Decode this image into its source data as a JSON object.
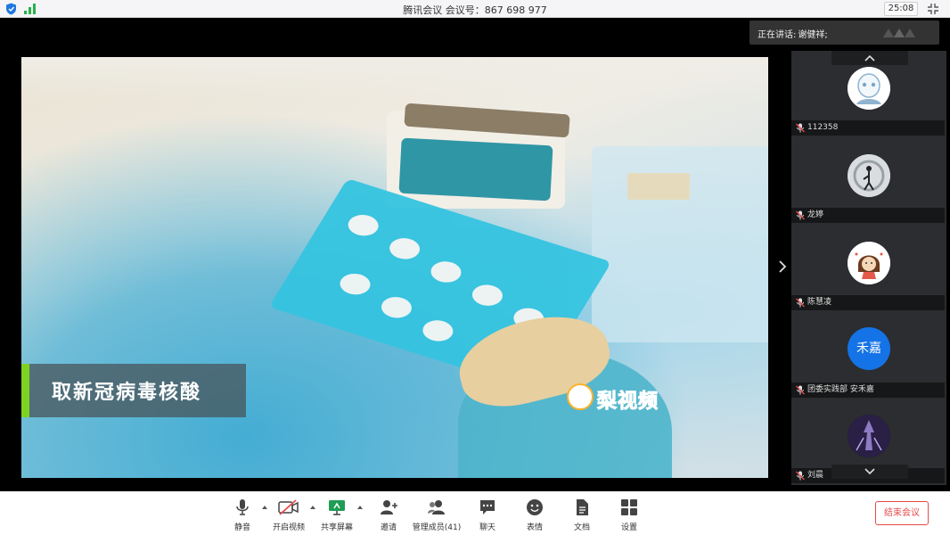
{
  "titlebar": {
    "title": "腾讯会议 会议号：867 698 977",
    "timer": "25:08"
  },
  "speaking": {
    "label": "正在讲话:",
    "name": "谢健祥;"
  },
  "video": {
    "caption": "取新冠病毒核酸",
    "watermark": "梨视频"
  },
  "participants": [
    {
      "name": "112358",
      "avatar": "cartoon-face"
    },
    {
      "name": "龙婷",
      "avatar": "photo"
    },
    {
      "name": "陈慧凌",
      "avatar": "cartoon-girl"
    },
    {
      "name": "团委实践部 安禾嘉",
      "avatar_text": "禾嘉",
      "avatar_color": "#1473e6"
    },
    {
      "name": "刘晨",
      "avatar": "photo-dark"
    }
  ],
  "toolbar": {
    "mute": "静音",
    "video": "开启视频",
    "share": "共享屏幕",
    "invite": "邀请",
    "members": "管理成员(41)",
    "chat": "聊天",
    "emoji": "表情",
    "docs": "文档",
    "settings": "设置",
    "end": "结束会议"
  },
  "colors": {
    "accent_green": "#7ed321",
    "end_red": "#e64b4b",
    "avatar_blue": "#1473e6",
    "share_green": "#1f9d55"
  }
}
